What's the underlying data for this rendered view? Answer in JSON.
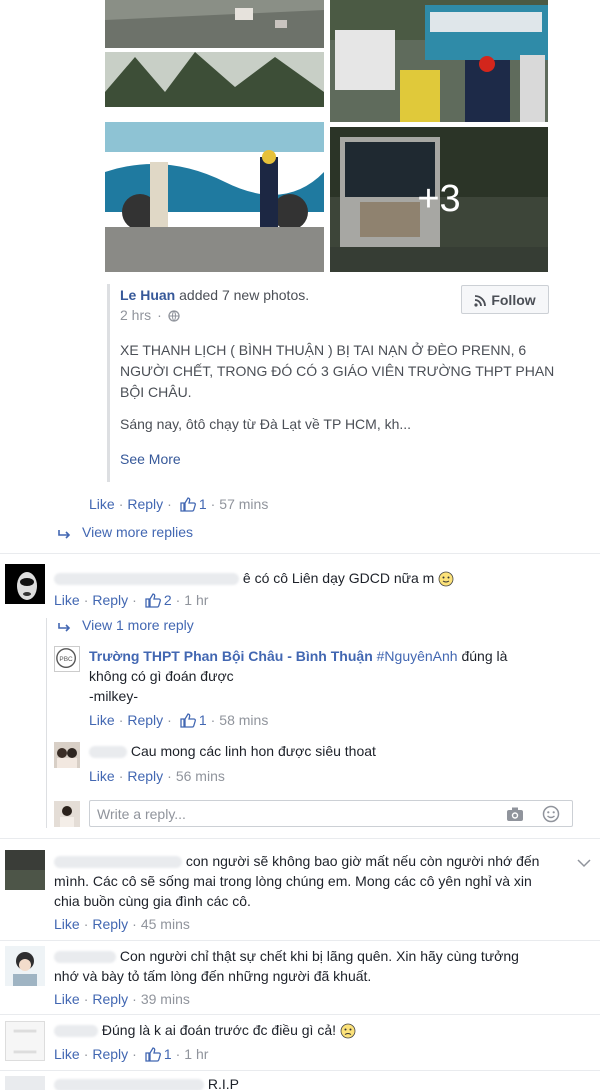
{
  "post": {
    "photo_overflow": "+3",
    "author": "Le Huan",
    "action": "added 7 new photos.",
    "time": "2 hrs",
    "privacy_icon": "globe-icon",
    "follow_label": "Follow",
    "headline": "XE THANH LỊCH ( BÌNH THUẬN ) BỊ TAI NẠN Ở ĐÈO PRENN, 6 NGƯỜI CHẾT, TRONG ĐÓ CÓ 3 GIÁO VIÊN TRƯỜNG THPT PHAN BỘI CHÂU.",
    "body": "Sáng nay, ôtô chạy từ Đà Lạt về TP HCM, kh...",
    "see_more": "See More",
    "actions": {
      "like": "Like",
      "reply": "Reply",
      "likes": "1",
      "time": "57 mins"
    },
    "view_more_replies": "View more replies"
  },
  "comments": [
    {
      "text": "ê có cô Liên dạy GDCD nữa m",
      "like": "Like",
      "reply": "Reply",
      "likes": "2",
      "time": "1 hr",
      "view_more": "View 1 more reply",
      "replies": [
        {
          "author": "Trường THPT Phan Bội Châu - Bình Thuận",
          "tag": "#NguyênAnh",
          "text_inline": "đúng là",
          "text_rest": "không có gì đoán được",
          "signature": "-milkey-",
          "like": "Like",
          "reply": "Reply",
          "likes": "1",
          "time": "58 mins"
        },
        {
          "text": "Cau mong các linh hon được siêu thoat",
          "like": "Like",
          "reply": "Reply",
          "time": "56 mins"
        }
      ],
      "write_reply_placeholder": "Write a reply..."
    },
    {
      "line1": "con người sẽ không bao giờ mất nếu còn người nhớ đến",
      "line2": "mình. Các cô sẽ sống mai trong lòng chúng em. Mong các cô yên nghỉ và xin",
      "line3": "chia buồn cùng gia đình các cô.",
      "like": "Like",
      "reply": "Reply",
      "time": "45 mins"
    },
    {
      "line1": "Con người chỉ thật sự chết khi bị lãng quên. Xin hãy cùng tưởng",
      "line2": "nhớ và bày tỏ tấm lòng đến những người đã khuất.",
      "like": "Like",
      "reply": "Reply",
      "time": "39 mins"
    },
    {
      "text": "Đúng là k ai đoán trước đc điều gì cả!",
      "like": "Like",
      "reply": "Reply",
      "likes": "1",
      "time": "1 hr"
    },
    {
      "text": "R.I.P"
    }
  ]
}
